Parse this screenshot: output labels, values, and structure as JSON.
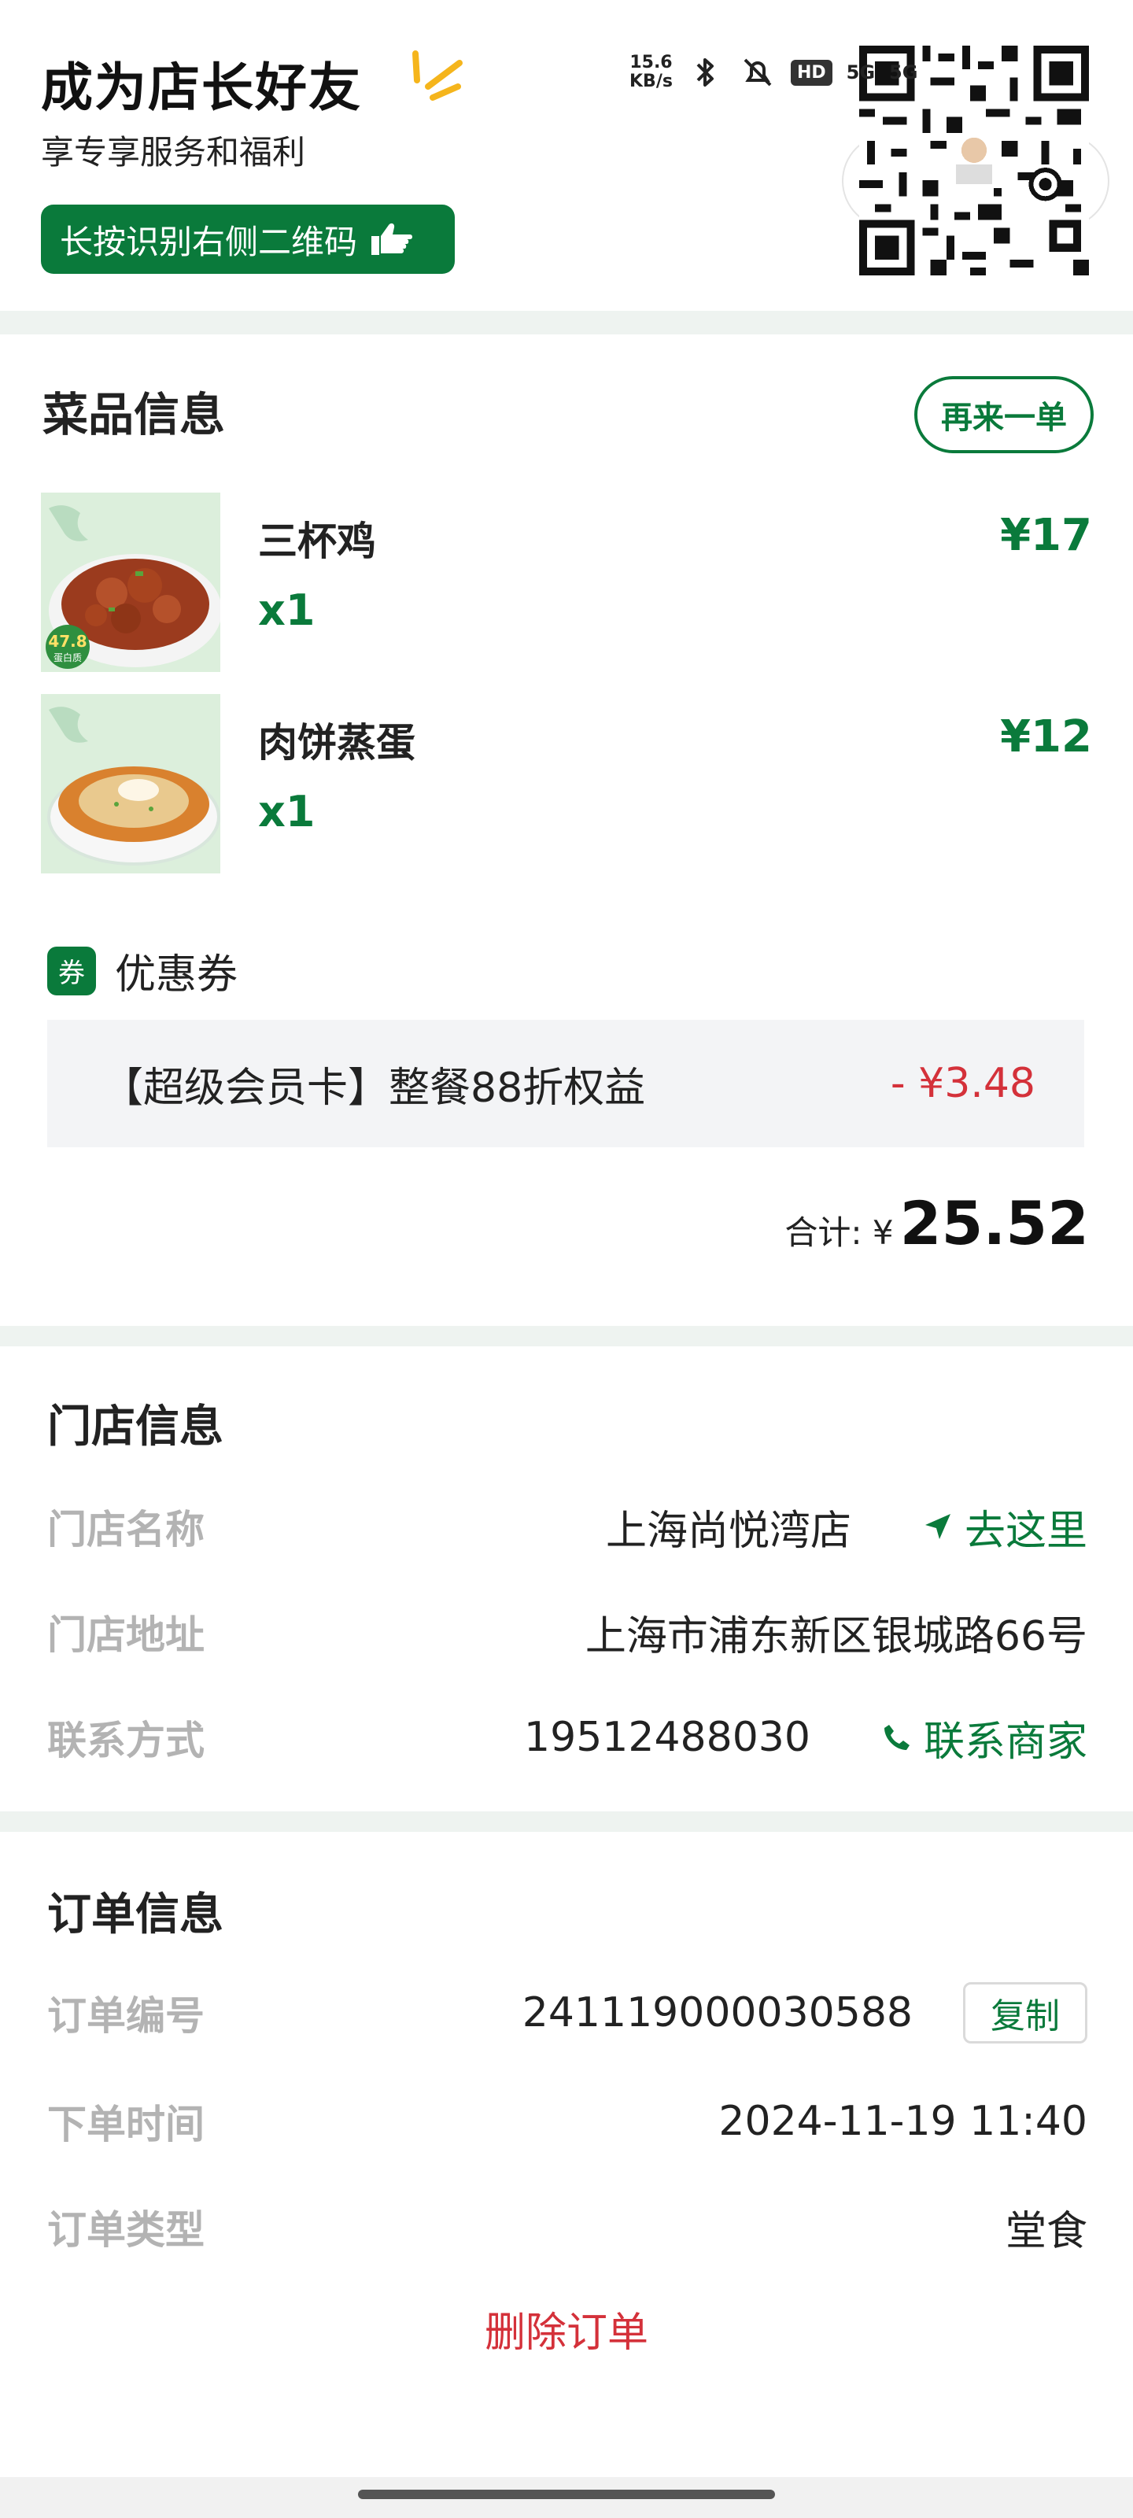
{
  "status_bar": {
    "net_speed_value": "15.6",
    "net_speed_unit": "KB/s",
    "hd_label": "HD",
    "signal_label_1": "5G",
    "signal_label_2": "5G"
  },
  "promo": {
    "title": "成为店长好友",
    "subtitle": "享专享服务和福利",
    "button_label": "长按识别右侧二维码"
  },
  "dishes": {
    "title": "菜品信息",
    "reorder_label": "再来一单",
    "items": [
      {
        "name": "三杯鸡",
        "qty": "x1",
        "price": "¥17",
        "badge": "47.8g 蛋白质"
      },
      {
        "name": "肉饼蒸蛋",
        "qty": "x1",
        "price": "¥12"
      }
    ],
    "coupon": {
      "tag": "券",
      "label": "优惠券",
      "name": "【超级会员卡】整餐88折权益",
      "amount": "- ¥3.48"
    },
    "total_label": "合计: ¥",
    "total_value": "25.52"
  },
  "store": {
    "title": "门店信息",
    "name_label": "门店名称",
    "name_value": "上海尚悦湾店",
    "navigate_label": "去这里",
    "address_label": "门店地址",
    "address_value": "上海市浦东新区银城路66号",
    "contact_label": "联系方式",
    "contact_value": "19512488030",
    "contact_link": "联系商家"
  },
  "order": {
    "title": "订单信息",
    "number_label": "订单编号",
    "number_value": "241119000030588",
    "copy_label": "复制",
    "time_label": "下单时间",
    "time_value": "2024-11-19 11:40",
    "type_label": "订单类型",
    "type_value": "堂食",
    "delete_label": "删除订单"
  },
  "colors": {
    "brand_green": "#0a7a3b",
    "discount_red": "#d4313a",
    "label_gray": "#b3b3b3",
    "band": "#eef3f0"
  }
}
